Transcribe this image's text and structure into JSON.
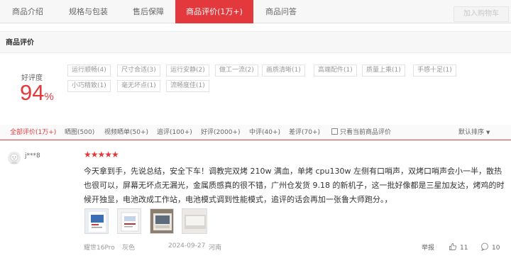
{
  "tabs": [
    {
      "label": "商品介绍",
      "active": false
    },
    {
      "label": "规格与包装",
      "active": false
    },
    {
      "label": "售后保障",
      "active": false
    },
    {
      "label": "商品评价(1万+)",
      "active": true
    },
    {
      "label": "商品问答",
      "active": false
    }
  ],
  "cart_button": "加入购物车",
  "section_title": "商品评价",
  "rating": {
    "label": "好评度",
    "value": "94",
    "unit": "%"
  },
  "tags": [
    "运行顺畅(4)",
    "尺寸合适(3)",
    "运行安静(2)",
    "做工一流(2)",
    "画质清晰(1)",
    "高端配件(1)",
    "质量上乘(1)",
    "手感十足(1)",
    "小巧精致(1)",
    "毫无坏点(1)",
    "流畅度佳(1)"
  ],
  "filters": [
    {
      "label": "全部评价(1万+)",
      "active": true
    },
    {
      "label": "晒图(500)",
      "active": false
    },
    {
      "label": "视频晒单(50+)",
      "active": false
    },
    {
      "label": "追评(100+)",
      "active": false
    },
    {
      "label": "好评(2000+)",
      "active": false
    },
    {
      "label": "中评(40+)",
      "active": false
    },
    {
      "label": "差评(70+)",
      "active": false
    }
  ],
  "current_only_label": "只看当前商品评价",
  "sort_label": "默认排序",
  "review": {
    "username": "j***8",
    "stars": "★★★★★",
    "text": "今天拿到手，先说总结，安全下车！调教完双烤 210w 满血，单烤 cpu130w 左侧有口哨声，双烤口哨声会小一半，散热也很可以，屏幕无坏点无漏光，金属质感真的很不错，广州仓发货 9.18 的新机子，这一批好像都是三星加友达，烤鸡的时候开独显，电池改成工作站，电池模式调到性能模式，追评的话会再加一张鲁大师跑分。，",
    "product": "耀世16Pro",
    "color": "灰色",
    "date": "2024-09-27",
    "location": "河南",
    "report_label": "举报",
    "likes": "11",
    "comments": "10"
  },
  "colors": {
    "accent": "#e4393c",
    "muted": "#999999"
  }
}
